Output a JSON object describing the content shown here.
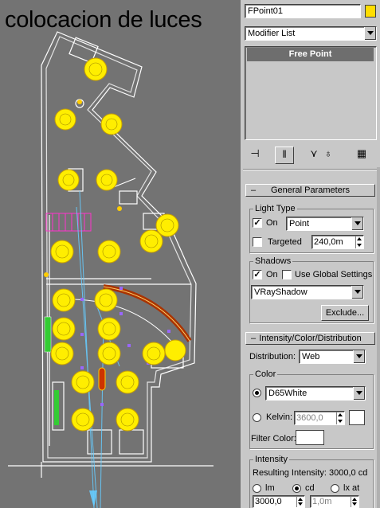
{
  "viewport": {
    "caption": "colocacion de luces"
  },
  "panel": {
    "object_name": "FPoint01",
    "object_color": "#ffdd00",
    "modifier_list": "Modifier List",
    "stack_item": "Free Point",
    "general_parameters": {
      "header": "General Parameters",
      "light_type_label": "Light Type",
      "on_label": "On",
      "on_checked": true,
      "type_value": "Point",
      "targeted_label": "Targeted",
      "targeted_checked": false,
      "targeted_distance": "240,0m",
      "shadows_label": "Shadows",
      "shadows_on_label": "On",
      "shadows_on_checked": true,
      "use_global_label": "Use Global Settings",
      "use_global_checked": false,
      "shadow_type": "VRayShadow",
      "exclude_label": "Exclude..."
    },
    "intensity": {
      "header": "Intensity/Color/Distribution",
      "distribution_label": "Distribution:",
      "distribution_value": "Web",
      "color_group_label": "Color",
      "color_preset": "D65White",
      "color_preset_selected": true,
      "kelvin_label": "Kelvin:",
      "kelvin_value": "3600,0",
      "kelvin_swatch": "#ffffff",
      "filter_color_label": "Filter Color:",
      "filter_color_swatch": "#ffffff",
      "intensity_group_label": "Intensity",
      "resulting_intensity": "Resulting Intensity: 3000,0 cd",
      "unit_lm": "lm",
      "unit_cd": "cd",
      "unit_lxat": "lx at",
      "selected_unit": "cd",
      "intensity_value": "3000,0",
      "lx_distance": "1,0m"
    }
  },
  "colors": {
    "viewport_bg": "#737373",
    "panel_bg": "#c8c8c8",
    "light_yellow": "#ffee00",
    "wall_white": "#ffffff",
    "selection_bar": "#6e6e6e"
  }
}
